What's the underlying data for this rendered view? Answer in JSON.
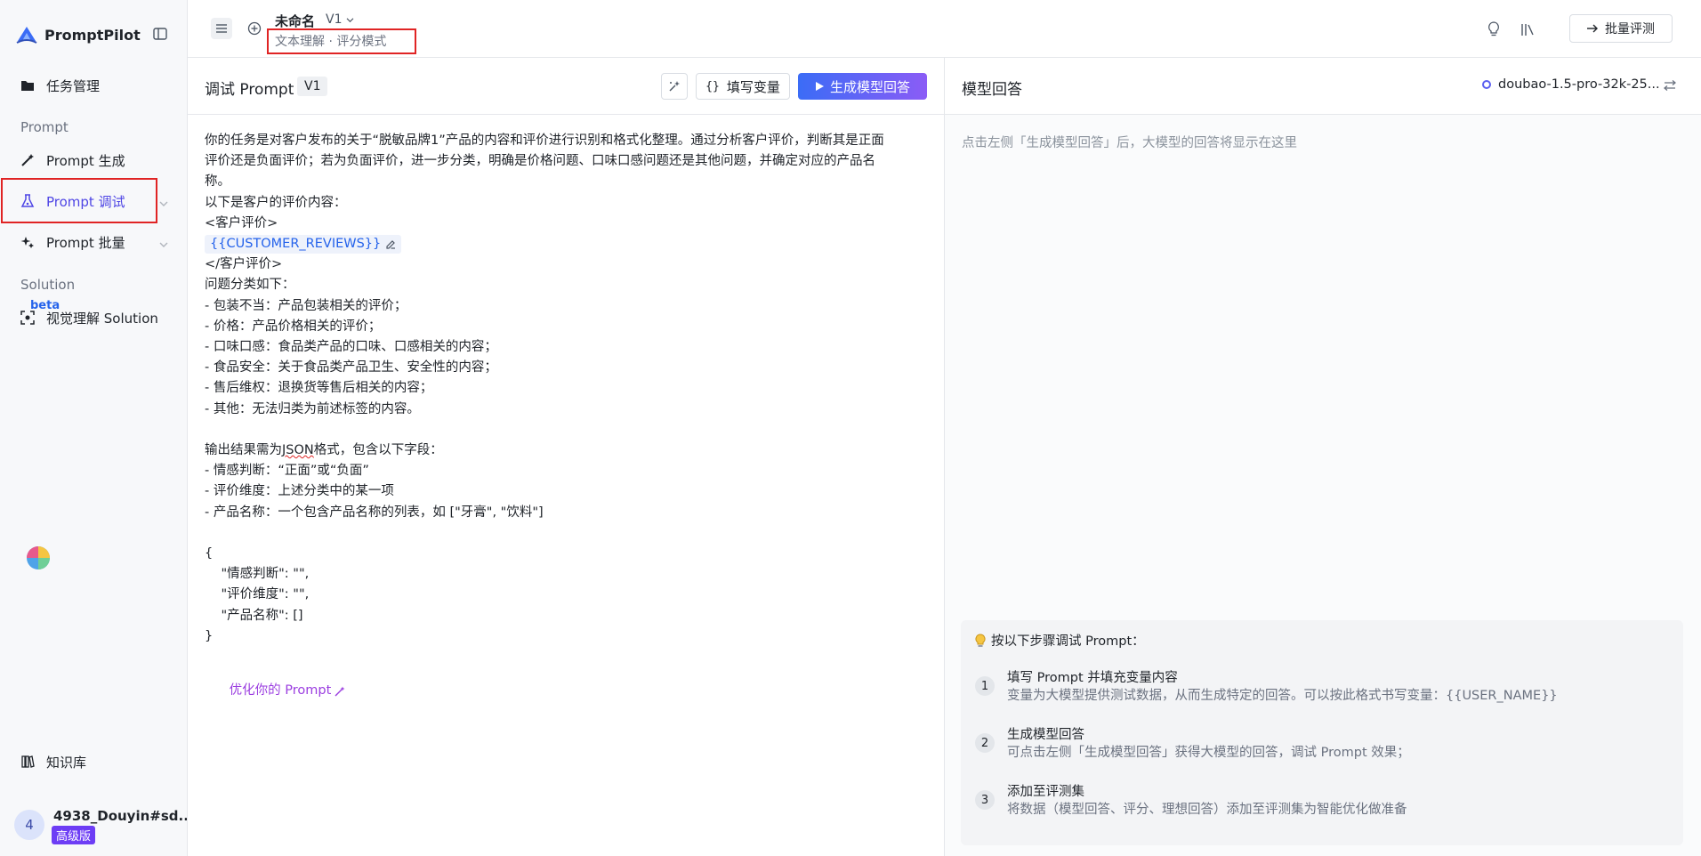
{
  "brand": {
    "name": "PromptPilot"
  },
  "sidebar": {
    "task_management": "任务管理",
    "section_prompt": "Prompt",
    "prompt_generate": "Prompt 生成",
    "prompt_debug": "Prompt 调试",
    "prompt_batch": "Prompt 批量",
    "section_solution": "Solution",
    "beta": "beta",
    "visual_solution": "视觉理解 Solution",
    "knowledge_base": "知识库"
  },
  "user": {
    "avatar_initial": "4",
    "name": "4938_Douyin#sd...",
    "plan": "高级版"
  },
  "topbar": {
    "doc_title": "未命名",
    "doc_version": "V1",
    "doc_subtitle": "文本理解 · 评分模式",
    "batch_eval": "批量评测"
  },
  "prompt_panel": {
    "title": "调试 Prompt",
    "version": "V1",
    "fill_variables": "填写变量",
    "generate": "生成模型回答",
    "lines": [
      "你的任务是对客户发布的关于“脱敏品牌1”产品的内容和评价进行识别和格式化整理。通过分析客户评价，判断其是正面",
      "评价还是负面评价；若为负面评价，进一步分类，明确是价格问题、口味口感问题还是其他问题，并确定对应的产品名",
      "称。",
      "以下是客户的评价内容：",
      "<客户评价>"
    ],
    "variable": "{{CUSTOMER_REVIEWS}}",
    "lines2": [
      "</客户评价>",
      "问题分类如下：",
      "- 包装不当：产品包装相关的评价；",
      "- 价格：产品价格相关的评价；",
      "- 口味口感：食品类产品的口味、口感相关的内容；",
      "- 食品安全：关于食品类产品卫生、安全性的内容；",
      "- 售后维权：退换货等售后相关的内容；",
      "- 其他：无法归类为前述标签的内容。",
      ""
    ],
    "output_prefix": "输出结果需为",
    "output_json": "JSON",
    "output_suffix": "格式，包含以下字段：",
    "lines3": [
      "- 情感判断：“正面”或“负面”",
      "- 评价维度：上述分类中的某一项",
      "- 产品名称：一个包含产品名称的列表，如 [\"牙膏\", \"饮料\"]",
      "",
      "{",
      "    \"情感判断\": \"\",",
      "    \"评价维度\": \"\",",
      "    \"产品名称\": []",
      "}"
    ],
    "optimize": "优化你的 Prompt"
  },
  "response_panel": {
    "title": "模型回答",
    "model": "doubao-1.5-pro-32k-25...",
    "placeholder": "点击左侧「生成模型回答」后，大模型的回答将显示在这里",
    "steps_heading": "按以下步骤调试 Prompt：",
    "steps": [
      {
        "num": "1",
        "title": "填写 Prompt 并填充变量内容",
        "desc": "变量为大模型提供测试数据，从而生成特定的回答。可以按此格式书写变量：{{USER_NAME}}"
      },
      {
        "num": "2",
        "title": "生成模型回答",
        "desc": "可点击左侧「生成模型回答」获得大模型的回答，调试 Prompt 效果；"
      },
      {
        "num": "3",
        "title": "添加至评测集",
        "desc": "将数据（模型回答、评分、理想回答）添加至评测集为智能优化做准备"
      }
    ]
  },
  "colors": {
    "accent": "#4f46e5",
    "highlight": "#e02424",
    "variable": "#2563eb",
    "optimize": "#9b3ee0"
  }
}
